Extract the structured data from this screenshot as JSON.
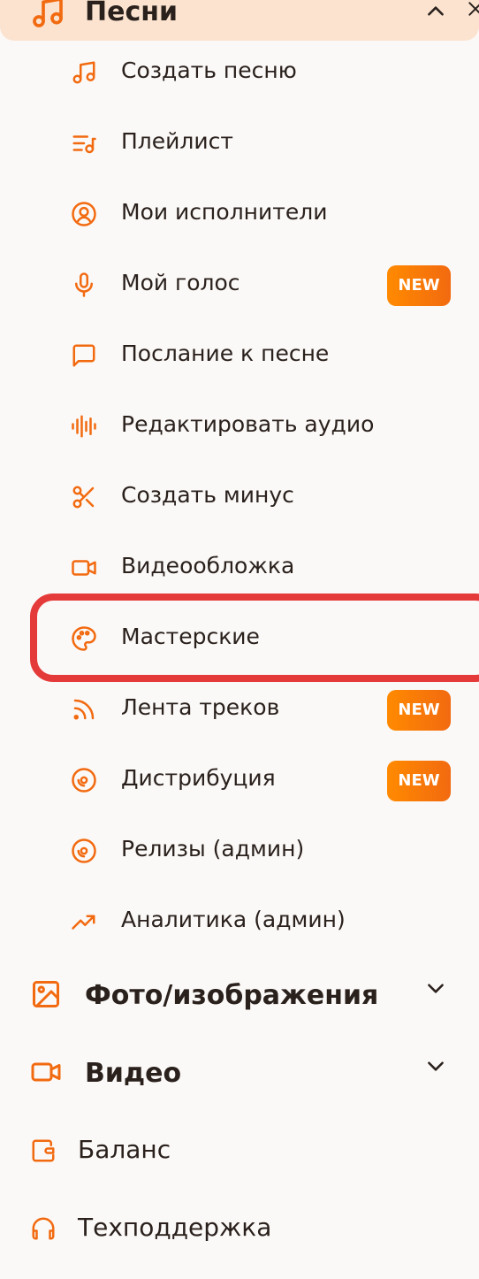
{
  "section": {
    "title": "Песни",
    "icon": "music-notes-icon",
    "expanded": true
  },
  "sub_items": [
    {
      "label": "Создать песню",
      "icon": "music-note-icon"
    },
    {
      "label": "Плейлист",
      "icon": "playlist-icon"
    },
    {
      "label": "Мои исполнители",
      "icon": "user-circle-icon"
    },
    {
      "label": "Мой голос",
      "icon": "microphone-icon",
      "badge": "NEW"
    },
    {
      "label": "Послание к песне",
      "icon": "message-square-icon"
    },
    {
      "label": "Редактировать аудио",
      "icon": "audio-waveform-icon"
    },
    {
      "label": "Создать минус",
      "icon": "scissors-icon"
    },
    {
      "label": "Видеообложка",
      "icon": "video-camera-icon"
    },
    {
      "label": "Мастерские",
      "icon": "palette-icon",
      "highlighted": true
    },
    {
      "label": "Лента треков",
      "icon": "rss-feed-icon",
      "badge": "NEW"
    },
    {
      "label": "Дистрибуция",
      "icon": "disc-icon",
      "badge": "NEW"
    },
    {
      "label": "Релизы (админ)",
      "icon": "disc-icon"
    },
    {
      "label": "Аналитика (админ)",
      "icon": "trending-up-icon"
    }
  ],
  "main_items": [
    {
      "title": "Фото/изображения",
      "icon": "image-icon"
    },
    {
      "title": "Видео",
      "icon": "video-camera-icon"
    }
  ],
  "simple_items": [
    {
      "label": "Баланс",
      "icon": "wallet-icon"
    },
    {
      "label": "Техподдержка",
      "icon": "headphones-icon"
    }
  ],
  "colors": {
    "accent": "#f26a10",
    "header_bg": "#fbe3cf",
    "highlight_border": "#e53a3a",
    "text": "#2a211d",
    "background": "#fbf9f7"
  }
}
